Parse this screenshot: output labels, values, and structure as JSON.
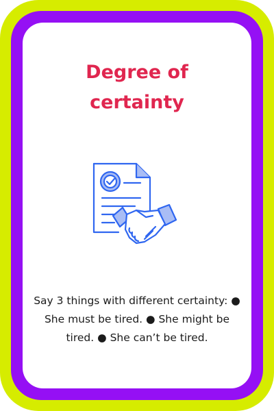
{
  "card": {
    "title_line1": "Degree of",
    "title_line2": "certainty",
    "body": "Say 3 things with different certainty: ● She must be tired. ● She might be tired. ● She can’t be tired.",
    "icon": "document-handshake-icon"
  },
  "colors": {
    "outer_frame": "#d6ec00",
    "inner_frame": "#9510f4",
    "title": "#e0264f",
    "icon_stroke": "#2f66f0",
    "icon_fill": "#a9bdf5",
    "text": "#1b1b1b"
  }
}
